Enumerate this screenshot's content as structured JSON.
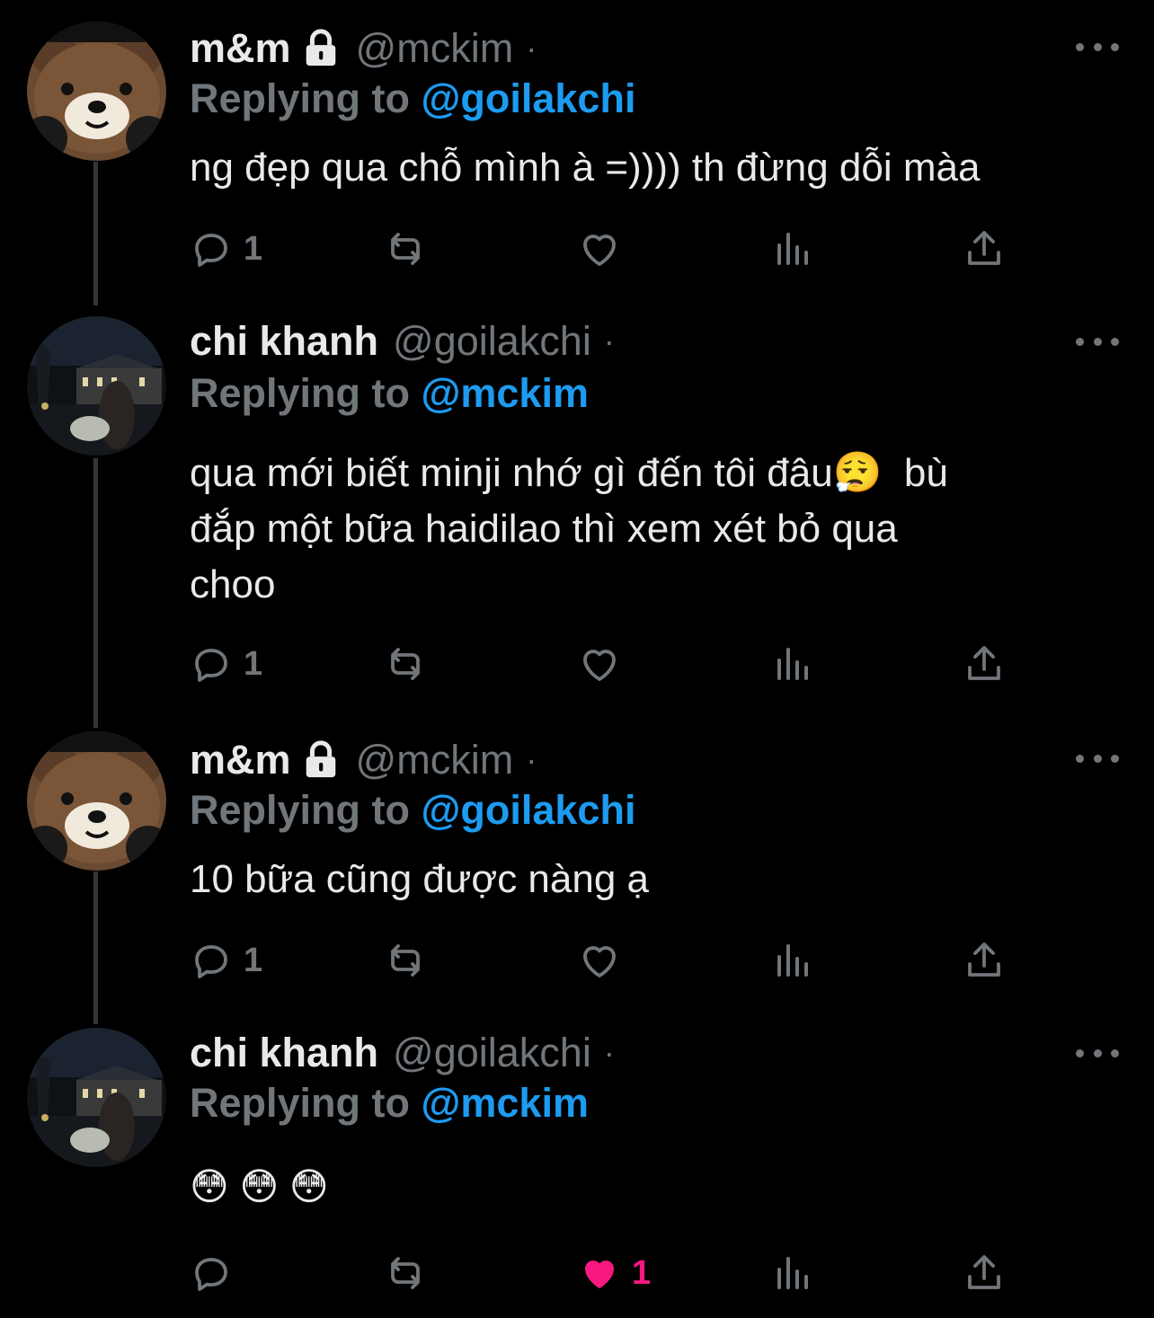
{
  "tweets": [
    {
      "name": "m&m",
      "locked": true,
      "handle": "@mckim",
      "dot": "·",
      "replying_prefix": "Replying to",
      "replying_to": "@goilakchi",
      "text": "ng đẹp qua chỗ mình à =)))) th đừng dỗi màa",
      "reply_count": "1",
      "like_count": "",
      "avatar": "bear-avatar"
    },
    {
      "name": "chi khanh",
      "locked": false,
      "handle": "@goilakchi",
      "dot": "·",
      "replying_prefix": "Replying to",
      "replying_to": "@mckim",
      "text": "qua mới biết minji nhớ gì đến tôi đâu😮‍💨  bù\nđắp một bữa haidilao thì xem xét bỏ qua\nchoo",
      "reply_count": "1",
      "like_count": "",
      "avatar": "night-photo-avatar"
    },
    {
      "name": "m&m",
      "locked": true,
      "handle": "@mckim",
      "dot": "·",
      "replying_prefix": "Replying to",
      "replying_to": "@goilakchi",
      "text": "10 bữa cũng được nàng ạ",
      "reply_count": "1",
      "like_count": "",
      "avatar": "bear-avatar"
    },
    {
      "name": "chi khanh",
      "locked": false,
      "handle": "@goilakchi",
      "dot": "·",
      "replying_prefix": "Replying to",
      "replying_to": "@mckim",
      "text": "😳 😳 😳",
      "reply_count": "",
      "like_count": "1",
      "liked": true,
      "avatar": "night-photo-avatar"
    }
  ],
  "icons": {
    "reply": "reply-icon",
    "retweet": "retweet-icon",
    "like": "like-icon",
    "views": "views-icon",
    "share": "share-icon",
    "more": "more-icon",
    "lock": "lock-icon"
  },
  "colors": {
    "background": "#000000",
    "text": "#e7e9ea",
    "muted": "#71767b",
    "mention": "#1d9bf0",
    "like": "#f91880"
  }
}
